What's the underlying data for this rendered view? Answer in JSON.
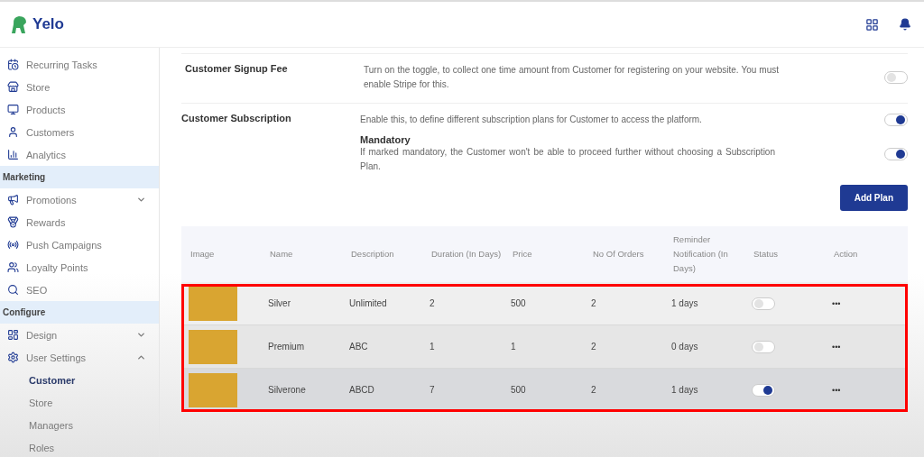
{
  "brand": {
    "name": "Yelo"
  },
  "sidebar": {
    "items": [
      {
        "kind": "item",
        "label": "Recurring Tasks"
      },
      {
        "kind": "item",
        "label": "Store"
      },
      {
        "kind": "item",
        "label": "Products"
      },
      {
        "kind": "item",
        "label": "Customers"
      },
      {
        "kind": "item",
        "label": "Analytics"
      },
      {
        "kind": "section",
        "label": "Marketing"
      },
      {
        "kind": "group",
        "label": "Promotions",
        "expanded": false
      },
      {
        "kind": "item",
        "label": "Rewards"
      },
      {
        "kind": "item",
        "label": "Push Campaigns"
      },
      {
        "kind": "item",
        "label": "Loyalty Points"
      },
      {
        "kind": "item",
        "label": "SEO"
      },
      {
        "kind": "section",
        "label": "Configure"
      },
      {
        "kind": "group",
        "label": "Design",
        "expanded": false
      },
      {
        "kind": "group",
        "label": "User Settings",
        "expanded": true
      },
      {
        "kind": "subitem",
        "label": "Customer",
        "selected": true
      },
      {
        "kind": "subitem",
        "label": "Store",
        "selected": false
      },
      {
        "kind": "subitem",
        "label": "Managers",
        "selected": false
      },
      {
        "kind": "subitem",
        "label": "Roles",
        "selected": false
      }
    ]
  },
  "settings": [
    {
      "title": "Customer Signup Fee",
      "options": [
        {
          "description": "Turn on the toggle, to collect one time amount from Customer for registering on your website. You must enable Stripe for this.",
          "on": false
        }
      ]
    },
    {
      "title": "Customer Subscription",
      "options": [
        {
          "description": "Enable this, to define different subscription plans for Customer to access the platform.",
          "on": true
        },
        {
          "heading": "Mandatory",
          "description": "If marked mandatory, the Customer won't be able to proceed further without choosing a Subscription Plan.",
          "on": true
        }
      ]
    }
  ],
  "add_plan_button": "Add Plan",
  "table": {
    "columns": [
      "Image",
      "Name",
      "Description",
      "Duration (In Days)",
      "Price",
      "No Of Orders",
      "Reminder Notification (In Days)",
      "Status",
      "Action"
    ],
    "rows": [
      {
        "name": "Silver",
        "description": "Unlimited",
        "duration": "2",
        "price": "500",
        "orders": "2",
        "reminder": "1 days",
        "status_on": false,
        "action": "•••"
      },
      {
        "name": "Premium",
        "description": "ABC",
        "duration": "1",
        "price": "1",
        "orders": "2",
        "reminder": "0 days",
        "status_on": false,
        "action": "•••"
      },
      {
        "name": "Silverone",
        "description": "ABCD",
        "duration": "7",
        "price": "500",
        "orders": "2",
        "reminder": "1 days",
        "status_on": true,
        "action": "•••"
      }
    ]
  }
}
